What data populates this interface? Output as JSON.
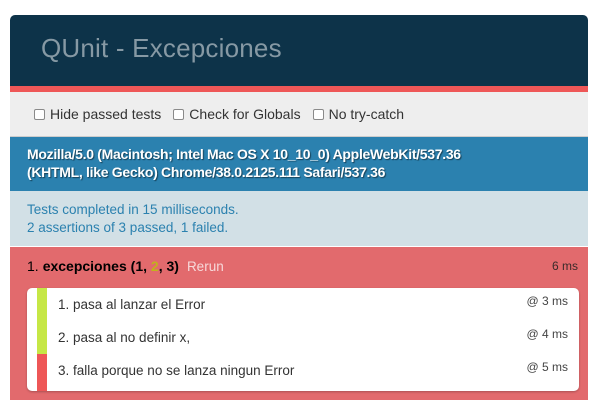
{
  "header": {
    "title": "QUnit - Excepciones"
  },
  "toolbar": {
    "hide_passed_label": "Hide passed tests",
    "check_globals_label": "Check for Globals",
    "no_try_catch_label": "No try-catch"
  },
  "useragent": {
    "line1": "Mozilla/5.0 (Macintosh; Intel Mac OS X 10_10_0) AppleWebKit/537.36",
    "line2": "(KHTML, like Gecko) Chrome/38.0.2125.111 Safari/537.36"
  },
  "testresult": {
    "line1": "Tests completed in 15 milliseconds.",
    "line2": "2 assertions of 3 passed, 1 failed."
  },
  "module": {
    "number": "1.",
    "name": "excepciones",
    "count_open": "(",
    "failed": "1",
    "sep1": ", ",
    "passed": "2",
    "sep2": ", ",
    "total": "3",
    "count_close": ")",
    "rerun_label": "Rerun",
    "runtime": "6 ms",
    "assertions": [
      {
        "text": "1. pasa al lanzar el Error",
        "time": "@ 3 ms",
        "status": "pass"
      },
      {
        "text": "2. pasa al no definir x,",
        "time": "@ 4 ms",
        "status": "pass"
      },
      {
        "text": "3. falla porque no se lanza ningun Error",
        "time": "@ 5 ms",
        "status": "fail"
      }
    ]
  },
  "colors": {
    "header_bg": "#0d3349",
    "banner_fail": "#ee5757",
    "useragent_bg": "#2b81af",
    "module_fail_bg": "#e26a6d",
    "assert_pass": "#c6e746",
    "assert_fail": "#ee5757"
  }
}
